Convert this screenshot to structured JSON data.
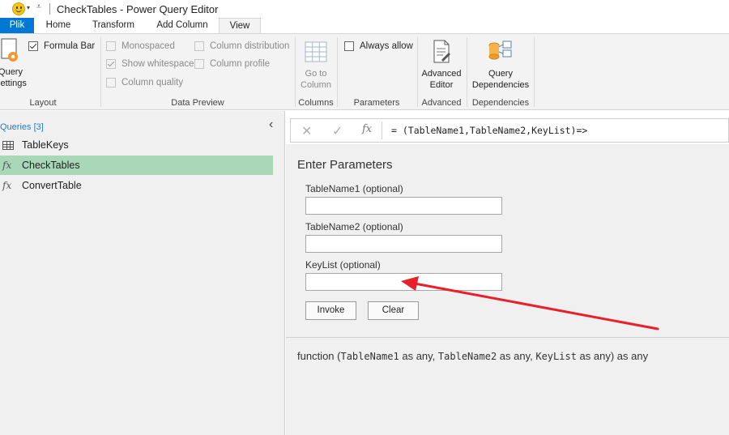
{
  "window": {
    "title": "CheckTables - Power Query Editor"
  },
  "ribbon_tabs": [
    "Plik",
    "Home",
    "Transform",
    "Add Column",
    "View"
  ],
  "ribbon": {
    "layout": {
      "query_settings": [
        "Query",
        "Settings"
      ],
      "formula_bar": "Formula Bar",
      "group_label": "Layout"
    },
    "data_preview": {
      "monospaced": "Monospaced",
      "show_whitespace": "Show whitespace",
      "column_quality": "Column quality",
      "column_distribution": "Column distribution",
      "column_profile": "Column profile",
      "group_label": "Data Preview"
    },
    "columns": {
      "go_to_column": [
        "Go to",
        "Column"
      ],
      "group_label": "Columns"
    },
    "parameters": {
      "always_allow": "Always allow",
      "group_label": "Parameters"
    },
    "advanced": {
      "advanced_editor": [
        "Advanced",
        "Editor"
      ],
      "group_label": "Advanced"
    },
    "dependencies": {
      "query_dependencies": [
        "Query",
        "Dependencies"
      ],
      "group_label": "Dependencies"
    }
  },
  "queries": {
    "header": "Queries [3]",
    "items": [
      {
        "label": "TableKeys",
        "icon": "table-icon"
      },
      {
        "label": "CheckTables",
        "icon": "function-icon"
      },
      {
        "label": "ConvertTable",
        "icon": "function-icon"
      }
    ]
  },
  "formula_bar": {
    "fx": "fx",
    "text": "= (TableName1,TableName2,KeyList)=>"
  },
  "parameters_panel": {
    "title": "Enter Parameters",
    "fields": [
      {
        "label": "TableName1 (optional)",
        "value": ""
      },
      {
        "label": "TableName2 (optional)",
        "value": ""
      },
      {
        "label": "KeyList (optional)",
        "value": ""
      }
    ],
    "invoke": "Invoke",
    "clear": "Clear"
  },
  "signature": {
    "prefix": "function (",
    "p1": "TableName1",
    "as1": " as any, ",
    "p2": "TableName2",
    "as2": " as any, ",
    "p3": "KeyList",
    "as3": " as any) as any"
  },
  "colors": {
    "file_tab": "#0078d4",
    "selected_query": "#a8d8b8",
    "annotation_arrow": "#e8202a",
    "queries_header": "#1e7fc6"
  }
}
